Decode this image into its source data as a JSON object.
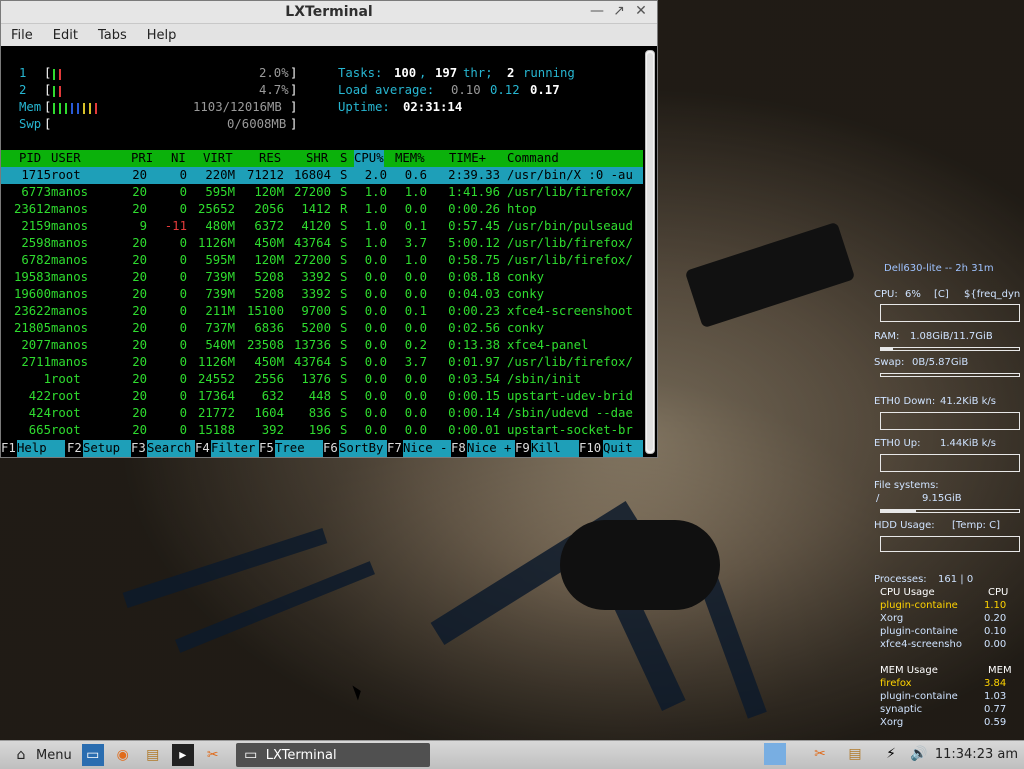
{
  "window": {
    "title": "LXTerminal",
    "buttons": {
      "minimize": "—",
      "restore": "↗",
      "close": "✕"
    },
    "menu": [
      "File",
      "Edit",
      "Tabs",
      "Help"
    ]
  },
  "htop": {
    "meters": {
      "cpu1": {
        "label": "1",
        "value": "2.0%"
      },
      "cpu2": {
        "label": "2",
        "value": "4.7%"
      },
      "mem": {
        "label": "Mem",
        "value": "1103/12016MB"
      },
      "swp": {
        "label": "Swp",
        "value": "0/6008MB"
      }
    },
    "summary": {
      "tasks_label": "Tasks:",
      "tasks_count": "100",
      "thr_count": "197",
      "thr_label": "thr;",
      "running_count": "2",
      "running_label": "running",
      "load_label": "Load average:",
      "load1": "0.10",
      "load5": "0.12",
      "load15": "0.17",
      "uptime_label": "Uptime:",
      "uptime": "02:31:14"
    },
    "columns": [
      "PID",
      "USER",
      "PRI",
      "NI",
      "VIRT",
      "RES",
      "SHR",
      "S",
      "CPU%",
      "MEM%",
      "TIME+",
      "Command"
    ],
    "processes": [
      [
        "1715",
        "root",
        "20",
        "0",
        "220M",
        "71212",
        "16804",
        "S",
        "2.0",
        "0.6",
        "2:39.33",
        "/usr/bin/X :0 -au"
      ],
      [
        "6773",
        "manos",
        "20",
        "0",
        "595M",
        "120M",
        "27200",
        "S",
        "1.0",
        "1.0",
        "1:41.96",
        "/usr/lib/firefox/"
      ],
      [
        "23612",
        "manos",
        "20",
        "0",
        "25652",
        "2056",
        "1412",
        "R",
        "1.0",
        "0.0",
        "0:00.26",
        "htop"
      ],
      [
        "2159",
        "manos",
        "9",
        "-11",
        "480M",
        "6372",
        "4120",
        "S",
        "1.0",
        "0.1",
        "0:57.45",
        "/usr/bin/pulseaud"
      ],
      [
        "2598",
        "manos",
        "20",
        "0",
        "1126M",
        "450M",
        "43764",
        "S",
        "1.0",
        "3.7",
        "5:00.12",
        "/usr/lib/firefox/"
      ],
      [
        "6782",
        "manos",
        "20",
        "0",
        "595M",
        "120M",
        "27200",
        "S",
        "0.0",
        "1.0",
        "0:58.75",
        "/usr/lib/firefox/"
      ],
      [
        "19583",
        "manos",
        "20",
        "0",
        "739M",
        "5208",
        "3392",
        "S",
        "0.0",
        "0.0",
        "0:08.18",
        "conky"
      ],
      [
        "19600",
        "manos",
        "20",
        "0",
        "739M",
        "5208",
        "3392",
        "S",
        "0.0",
        "0.0",
        "0:04.03",
        "conky"
      ],
      [
        "23622",
        "manos",
        "20",
        "0",
        "211M",
        "15100",
        "9700",
        "S",
        "0.0",
        "0.1",
        "0:00.23",
        "xfce4-screenshoot"
      ],
      [
        "21805",
        "manos",
        "20",
        "0",
        "737M",
        "6836",
        "5200",
        "S",
        "0.0",
        "0.0",
        "0:02.56",
        "conky"
      ],
      [
        "2077",
        "manos",
        "20",
        "0",
        "540M",
        "23508",
        "13736",
        "S",
        "0.0",
        "0.2",
        "0:13.38",
        "xfce4-panel"
      ],
      [
        "2711",
        "manos",
        "20",
        "0",
        "1126M",
        "450M",
        "43764",
        "S",
        "0.0",
        "3.7",
        "0:01.97",
        "/usr/lib/firefox/"
      ],
      [
        "1",
        "root",
        "20",
        "0",
        "24552",
        "2556",
        "1376",
        "S",
        "0.0",
        "0.0",
        "0:03.54",
        "/sbin/init"
      ],
      [
        "422",
        "root",
        "20",
        "0",
        "17364",
        "632",
        "448",
        "S",
        "0.0",
        "0.0",
        "0:00.15",
        "upstart-udev-brid"
      ],
      [
        "424",
        "root",
        "20",
        "0",
        "21772",
        "1604",
        "836",
        "S",
        "0.0",
        "0.0",
        "0:00.14",
        "/sbin/udevd --dae"
      ],
      [
        "665",
        "root",
        "20",
        "0",
        "15188",
        "392",
        "196",
        "S",
        "0.0",
        "0.0",
        "0:00.01",
        "upstart-socket-br"
      ]
    ],
    "fkeys": [
      {
        "key": "F1",
        "label": "Help"
      },
      {
        "key": "F2",
        "label": "Setup"
      },
      {
        "key": "F3",
        "label": "Search"
      },
      {
        "key": "F4",
        "label": "Filter"
      },
      {
        "key": "F5",
        "label": "Tree"
      },
      {
        "key": "F6",
        "label": "SortBy"
      },
      {
        "key": "F7",
        "label": "Nice -"
      },
      {
        "key": "F8",
        "label": "Nice +"
      },
      {
        "key": "F9",
        "label": "Kill"
      },
      {
        "key": "F10",
        "label": "Quit"
      }
    ]
  },
  "conky": {
    "header": "Dell630-lite -- 2h 31m",
    "cpu": {
      "label": "CPU:",
      "value": "6%",
      "temp": "[C]",
      "freq": "${freq_dyn"
    },
    "ram": {
      "label": "RAM:",
      "value": "1.08GiB/11.7GiB",
      "fill": 0.09
    },
    "swap": {
      "label": "Swap:",
      "value": "0B/5.87GiB",
      "fill": 0.0
    },
    "eth0_down": {
      "label": "ETH0 Down:",
      "value": "41.2KiB k/s"
    },
    "eth0_up": {
      "label": "ETH0 Up:",
      "value": "1.44KiB k/s"
    },
    "fs": {
      "label": "File systems:",
      "mount": "/",
      "value": "9.15GiB",
      "fill": 0.25
    },
    "hdd": {
      "label": "HDD Usage:",
      "temp": "[Temp: C]"
    },
    "processes": {
      "label": "Processes:",
      "value": "161 | 0"
    },
    "cpu_usage": {
      "title": "CPU Usage",
      "col": "CPU",
      "rows": [
        {
          "name": "plugin-containe",
          "value": "1.10"
        },
        {
          "name": "Xorg",
          "value": "0.20"
        },
        {
          "name": "plugin-containe",
          "value": "0.10"
        },
        {
          "name": "xfce4-screensho",
          "value": "0.00"
        }
      ]
    },
    "mem_usage": {
      "title": "MEM Usage",
      "col": "MEM",
      "rows": [
        {
          "name": "firefox",
          "value": "3.84"
        },
        {
          "name": "plugin-containe",
          "value": "1.03"
        },
        {
          "name": "synaptic",
          "value": "0.77"
        },
        {
          "name": "Xorg",
          "value": "0.59"
        }
      ]
    }
  },
  "taskbar": {
    "menu_label": "Menu",
    "task_label": "LXTerminal",
    "clock": "11:34:23 am"
  }
}
